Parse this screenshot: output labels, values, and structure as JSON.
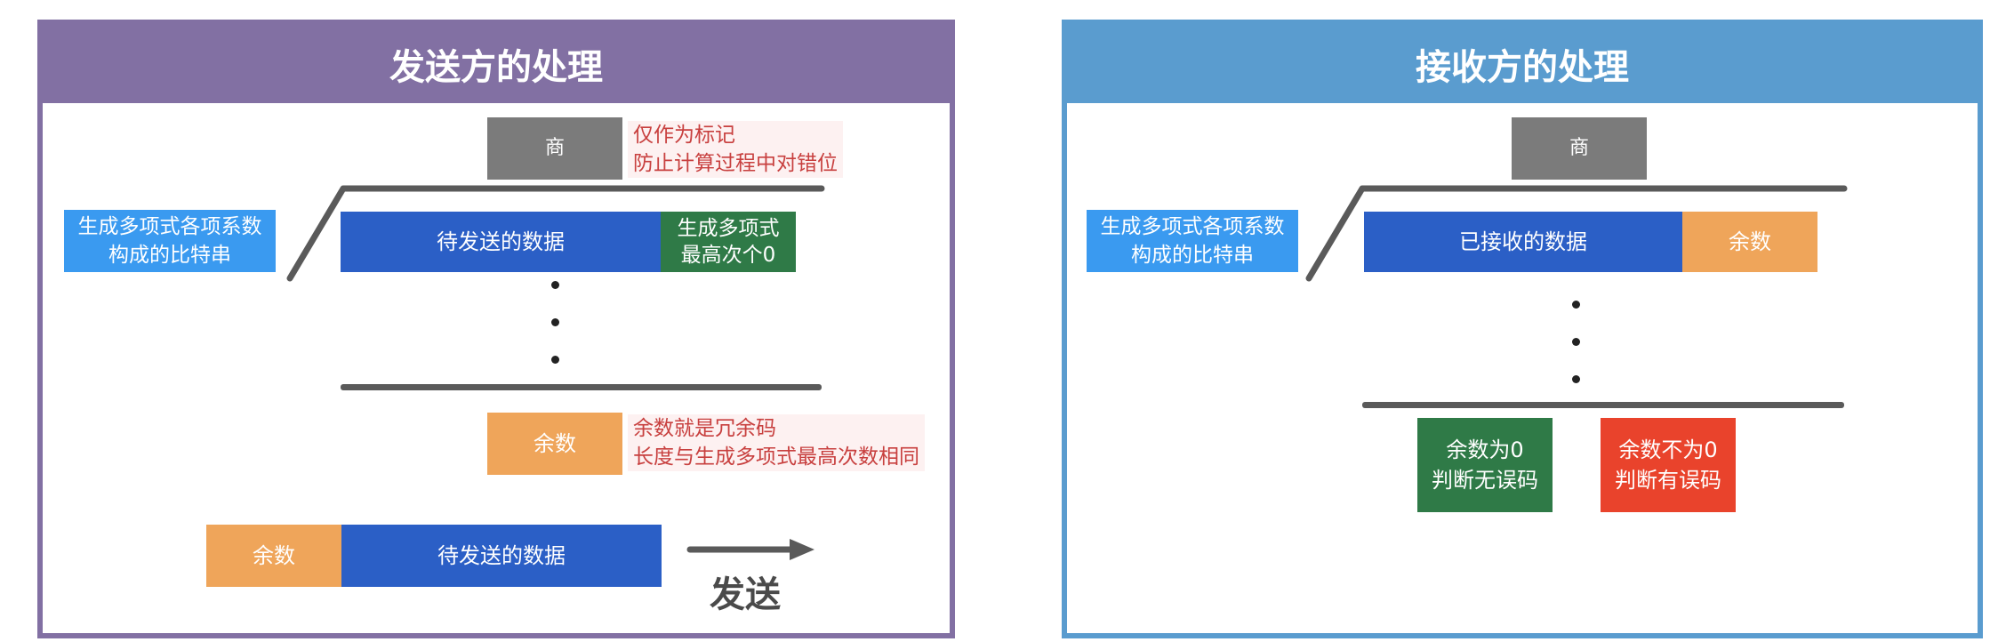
{
  "sender": {
    "title": "发送方的处理",
    "quotient": "商",
    "quotient_note": [
      "仅作为标记",
      "防止计算过程中对错位"
    ],
    "poly_label": [
      "生成多项式各项系数",
      "构成的比特串"
    ],
    "data_block": "待发送的数据",
    "zeros_block": [
      "生成多项式",
      "最高次个0"
    ],
    "remainder": "余数",
    "remainder_note": [
      "余数就是冗余码",
      "长度与生成多项式最高次数相同"
    ],
    "send_remainder": "余数",
    "send_data": "待发送的数据",
    "send_label": "发送"
  },
  "receiver": {
    "title": "接收方的处理",
    "quotient": "商",
    "poly_label": [
      "生成多项式各项系数",
      "构成的比特串"
    ],
    "data_block": "已接收的数据",
    "remainder_block": "余数",
    "result_ok": [
      "余数为0",
      "判断无误码"
    ],
    "result_err": [
      "余数不为0",
      "判断有误码"
    ]
  },
  "colors": {
    "sender_accent": "#8270a3",
    "receiver_accent": "#5a9ccf",
    "gray": "#7b7b7b",
    "blue": "#2b5fc6",
    "green": "#2f7a47",
    "orange": "#efa55a",
    "red": "#e9432c",
    "light_blue": "#3a9af0",
    "note_red": "#c8403f"
  }
}
